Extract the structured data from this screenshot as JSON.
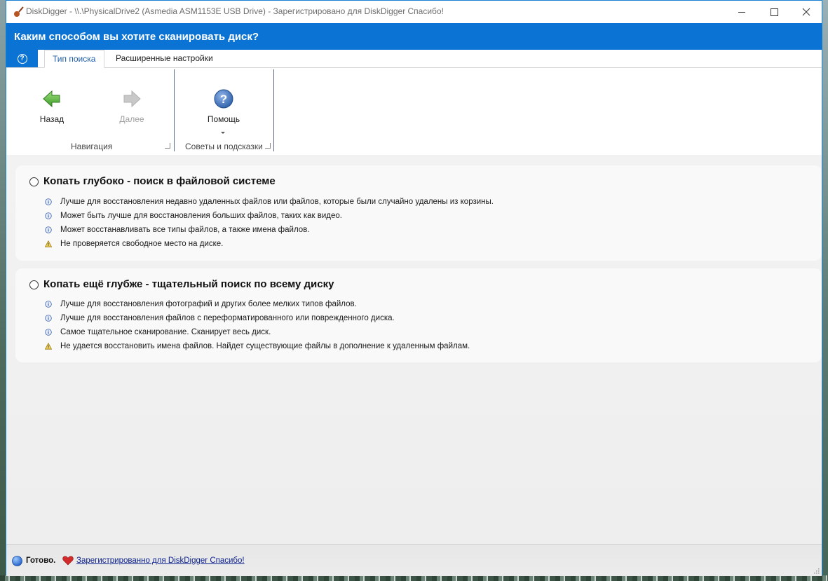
{
  "window": {
    "title": "DiskDigger - \\\\.\\PhysicalDrive2 (Asmedia ASM1153E USB Drive) - Зарегистрировано для DiskDigger  Спасибо!"
  },
  "header": {
    "title": "Каким способом вы хотите сканировать диск?"
  },
  "tabs": [
    {
      "label": "Тип поиска",
      "active": true
    },
    {
      "label": "Расширенные настройки",
      "active": false
    }
  ],
  "ribbon": {
    "navigation": {
      "label": "Навигация",
      "back_label": "Назад",
      "next_label": "Далее"
    },
    "tips": {
      "label": "Советы и подсказки",
      "help_label": "Помощь"
    }
  },
  "options": [
    {
      "title": "Копать глубоко - поиск в файловой системе",
      "selected": false,
      "bullets": [
        {
          "icon": "info-icon",
          "text": "Лучше для восстановления недавно удаленных файлов или файлов, которые были случайно удалены из корзины."
        },
        {
          "icon": "info-icon",
          "text": "Может быть лучше для восстановления больших файлов, таких как видео."
        },
        {
          "icon": "info-icon",
          "text": "Может восстанавливать все типы файлов, а также имена файлов."
        },
        {
          "icon": "warning-icon",
          "text": "Не проверяется свободное место на диске."
        }
      ]
    },
    {
      "title": "Копать ещё глубже - тщательный поиск по всему диску",
      "selected": false,
      "bullets": [
        {
          "icon": "info-icon",
          "text": "Лучше для восстановления фотографий и других более мелких типов файлов."
        },
        {
          "icon": "info-icon",
          "text": "Лучше для восстановления файлов с переформатированного или поврежденного диска."
        },
        {
          "icon": "info-icon",
          "text": "Самое тщательное сканирование. Сканирует весь диск."
        },
        {
          "icon": "warning-icon",
          "text": "Не удается восстановить имена файлов. Найдет существующие файлы в дополнение к удаленным файлам."
        }
      ]
    }
  ],
  "status": {
    "text": "Готово.",
    "link": "Зарегистрированно для DiskDigger  Спасибо!"
  },
  "colors": {
    "accent": "#0b73d4",
    "link": "#0a1f8c"
  }
}
